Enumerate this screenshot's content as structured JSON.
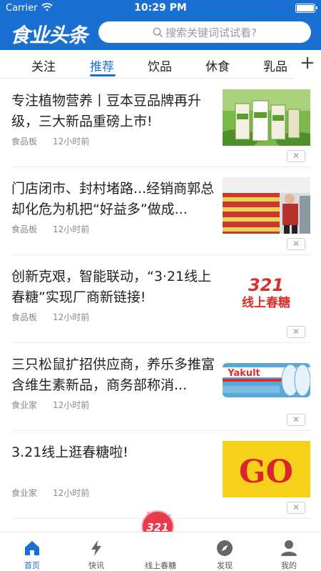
{
  "status_bar": {
    "carrier": "Carrier",
    "time": "10:29 PM"
  },
  "header": {
    "logo": "食业头条",
    "search_placeholder": "搜索关键词试试看?"
  },
  "tabs": [
    {
      "label": "关注",
      "active": false
    },
    {
      "label": "推荐",
      "active": true
    },
    {
      "label": "饮品",
      "active": false
    },
    {
      "label": "休食",
      "active": false
    },
    {
      "label": "乳品",
      "active": false
    }
  ],
  "feed": [
    {
      "title": "专注植物营养丨豆本豆品牌再升级，三大新品重磅上市!",
      "source": "食品板",
      "time": "12小时前",
      "close": "✕"
    },
    {
      "title": "门店闭市、封村堵路...经销商郭总却化危为机把“好益多”做成...",
      "source": "食品板",
      "time": "12小时前",
      "close": "✕"
    },
    {
      "title": "创新克艰，智能联动，“3·21线上春糖”实现厂商新链接!",
      "source": "食品板",
      "time": "12小时前",
      "close": "✕",
      "thumb_text_num": "321",
      "thumb_text": "线上春糖"
    },
    {
      "title": "三只松鼠扩招供应商，养乐多推富含维生素新品，商务部称消...",
      "source": "食业家",
      "time": "12小时前",
      "close": "✕",
      "thumb_text": "Yakult"
    },
    {
      "title": "3.21线上逛春糖啦!",
      "source": "食业家",
      "time": "12小时前",
      "close": "✕",
      "thumb_text": "GO"
    }
  ],
  "tabbar": [
    {
      "label": "首页",
      "icon": "home-icon",
      "active": true
    },
    {
      "label": "快讯",
      "icon": "lightning-icon",
      "active": false
    },
    {
      "label": "线上春糖",
      "icon": "spring-fair-icon",
      "active": false
    },
    {
      "label": "发现",
      "icon": "compass-icon",
      "active": false
    },
    {
      "label": "我的",
      "icon": "user-icon",
      "active": false
    }
  ],
  "fab": {
    "label": "321"
  },
  "colors": {
    "brand_blue": "#1A6FD3",
    "meta_gray": "#888888"
  }
}
